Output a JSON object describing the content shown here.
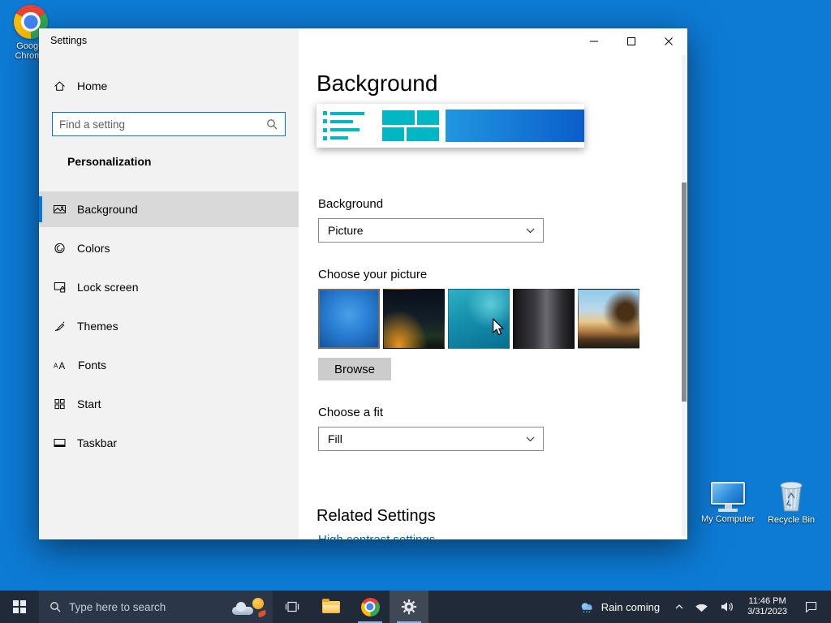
{
  "colors": {
    "accent": "#0078d7",
    "teal_preview": "#00b7c3",
    "desktop_background": "#0d7ad4",
    "taskbar_background": "#202a38",
    "link": "#0066b4"
  },
  "desktop": {
    "chrome_icon_label": "Google Chrome",
    "my_computer_label": "My Computer",
    "recycle_bin_label": "Recycle Bin"
  },
  "window": {
    "title": "Settings",
    "caption_icons": [
      "minimize-icon",
      "maximize-icon",
      "close-icon"
    ],
    "sidebar": {
      "home_label": "Home",
      "search_placeholder": "Find a setting",
      "section_header": "Personalization",
      "items": [
        {
          "label": "Background",
          "icon": "image-icon",
          "selected": true
        },
        {
          "label": "Colors",
          "icon": "palette-icon",
          "selected": false
        },
        {
          "label": "Lock screen",
          "icon": "lock-screen-icon",
          "selected": false
        },
        {
          "label": "Themes",
          "icon": "brush-icon",
          "selected": false
        },
        {
          "label": "Fonts",
          "icon": "fonts-icon",
          "selected": false
        },
        {
          "label": "Start",
          "icon": "start-tiles-icon",
          "selected": false
        },
        {
          "label": "Taskbar",
          "icon": "taskbar-icon",
          "selected": false
        }
      ]
    },
    "content": {
      "page_title": "Background",
      "background_label": "Background",
      "background_dropdown_value": "Picture",
      "choose_picture_label": "Choose your picture",
      "thumbnails": [
        "windows-default-wallpaper",
        "night-sky-wallpaper",
        "ocean-wallpaper",
        "cliff-wallpaper",
        "beach-wallpaper"
      ],
      "browse_button_label": "Browse",
      "fit_label": "Choose a fit",
      "fit_dropdown_value": "Fill",
      "related_settings_title": "Related Settings",
      "related_link": "High contrast settings"
    }
  },
  "taskbar": {
    "search_placeholder": "Type here to search",
    "icons": [
      "start-icon",
      "search-icon",
      "task-view-icon",
      "file-explorer-icon",
      "chrome-icon",
      "settings-gear-icon",
      "weather-cloud-icon",
      "chevron-up-icon",
      "wifi-icon",
      "volume-icon",
      "action-center-icon"
    ],
    "weather_text": "Rain coming",
    "clock_time": "11:46 PM",
    "clock_date": "3/31/2023"
  }
}
